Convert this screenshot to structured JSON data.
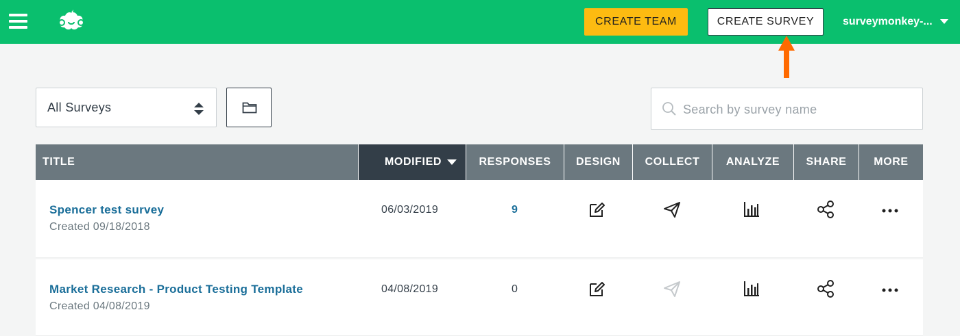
{
  "header": {
    "create_team": "CREATE TEAM",
    "create_survey": "CREATE SURVEY",
    "account": "surveymonkey-...",
    "brand_color": "#0abf6e"
  },
  "controls": {
    "filter_value": "All Surveys",
    "search_placeholder": "Search by survey name"
  },
  "table": {
    "headers": {
      "title": "TITLE",
      "modified": "MODIFIED",
      "responses": "RESPONSES",
      "design": "DESIGN",
      "collect": "COLLECT",
      "analyze": "ANALYZE",
      "share": "SHARE",
      "more": "MORE"
    },
    "rows": [
      {
        "title": "Spencer test survey",
        "created": "Created 09/18/2018",
        "modified": "06/03/2019",
        "responses": "9"
      },
      {
        "title": "Market Research - Product Testing Template",
        "created": "Created 04/08/2019",
        "modified": "04/08/2019",
        "responses": "0"
      }
    ]
  },
  "icons": {
    "menu": "hamburger-menu-icon",
    "logo": "surveymonkey-logo",
    "dropdown": "caret-down-icon",
    "updown": "sort-updown-icon",
    "folder": "folder-icon",
    "search": "search-icon",
    "design": "edit-icon",
    "collect": "send-icon",
    "analyze": "bar-chart-icon",
    "share": "share-icon",
    "more": "more-dots-icon",
    "annotation": "arrow-up-icon"
  }
}
